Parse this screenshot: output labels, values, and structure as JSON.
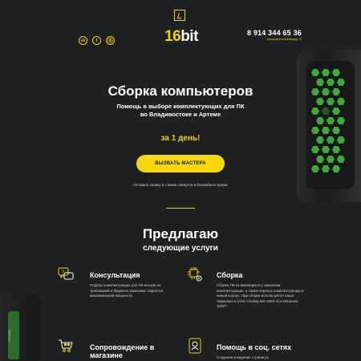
{
  "header": {
    "logo_number": "16",
    "logo_text": "bit",
    "phone": "8 914 344 65 36",
    "whatsapp_label": "написать в whatsapp",
    "socials": [
      "vk",
      "f",
      "ig"
    ]
  },
  "hero": {
    "title": "Сборка компьютеров",
    "subtitle_line1": "Помощь в выборе комплектующих для ПК",
    "subtitle_line2": "во Владивостоке и Артеме",
    "days": "за 1 день!",
    "cta_label": "ВЫЗВАТЬ МАСТЕРА",
    "cta_note": "Оставьте заявку и с Вами свяжутся в ближайшее время"
  },
  "offers": {
    "title": "Предлагаю",
    "subtitle": "следующие услуги",
    "items": [
      {
        "title": "Консультация",
        "desc": "Подбор комплектующих для ПК исходя из требований и бюджета заказчика. Гарантия максимальной мощности."
      },
      {
        "title": "Сборка",
        "desc": "Сборка ПК из имеющихся у заказчика комплектующих, а также перенос комплектующих в новый корпус. При сборке используется наша термопаста (Artic Cooling MX-2/MX-4) и Windows 10/8/7."
      },
      {
        "title": "Сопровождение в магазине",
        "desc": ""
      },
      {
        "title": "Помощь в соц. сетях",
        "desc": "Создание и ведение страниц в"
      }
    ]
  },
  "decor": {
    "pc2_label": "HX1000i"
  },
  "colors": {
    "background": "#1f2022",
    "accent": "#f2d200",
    "button": "#f6d80f",
    "pc_glow": "#3fa83a"
  },
  "icons": {
    "logo": "cursor-icon",
    "consultation": "chat-question-icon",
    "assembly": "chip-gear-icon",
    "shopping": "shopping-cart-icon",
    "social": "social-network-icon"
  }
}
